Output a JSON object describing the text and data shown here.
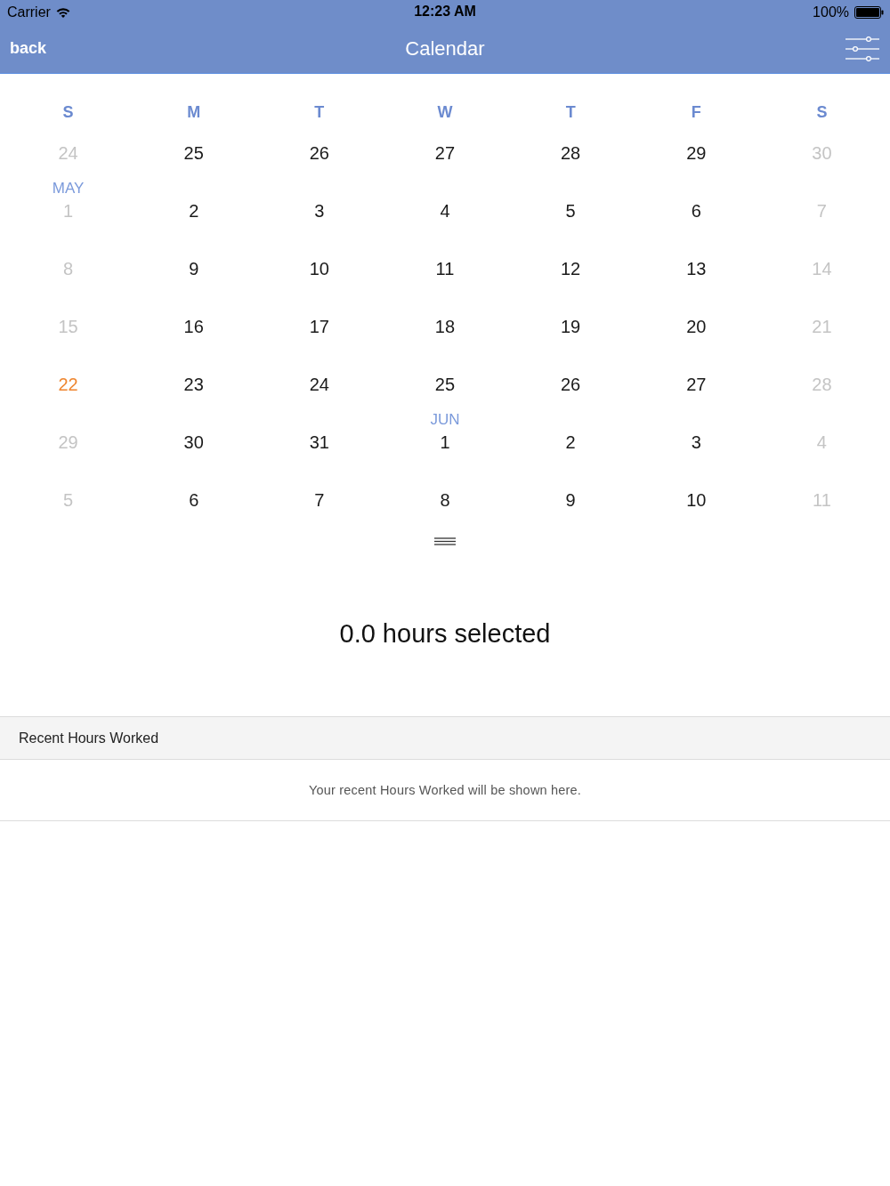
{
  "status_bar": {
    "carrier": "Carrier",
    "time": "12:23 AM",
    "battery": "100%"
  },
  "nav_bar": {
    "back": "back",
    "title": "Calendar"
  },
  "calendar": {
    "weekdays": [
      "S",
      "M",
      "T",
      "W",
      "T",
      "F",
      "S"
    ],
    "weeks": [
      [
        {
          "day": "24",
          "disabled": true,
          "today": false
        },
        {
          "day": "25",
          "disabled": false,
          "today": false
        },
        {
          "day": "26",
          "disabled": false,
          "today": false
        },
        {
          "day": "27",
          "disabled": false,
          "today": false
        },
        {
          "day": "28",
          "disabled": false,
          "today": false
        },
        {
          "day": "29",
          "disabled": false,
          "today": false
        },
        {
          "day": "30",
          "disabled": true,
          "today": false
        }
      ],
      [
        {
          "day": "1",
          "month": "MAY",
          "disabled": true,
          "today": false
        },
        {
          "day": "2",
          "disabled": false,
          "today": false
        },
        {
          "day": "3",
          "disabled": false,
          "today": false
        },
        {
          "day": "4",
          "disabled": false,
          "today": false
        },
        {
          "day": "5",
          "disabled": false,
          "today": false
        },
        {
          "day": "6",
          "disabled": false,
          "today": false
        },
        {
          "day": "7",
          "disabled": true,
          "today": false
        }
      ],
      [
        {
          "day": "8",
          "disabled": true,
          "today": false
        },
        {
          "day": "9",
          "disabled": false,
          "today": false
        },
        {
          "day": "10",
          "disabled": false,
          "today": false
        },
        {
          "day": "11",
          "disabled": false,
          "today": false
        },
        {
          "day": "12",
          "disabled": false,
          "today": false
        },
        {
          "day": "13",
          "disabled": false,
          "today": false
        },
        {
          "day": "14",
          "disabled": true,
          "today": false
        }
      ],
      [
        {
          "day": "15",
          "disabled": true,
          "today": false
        },
        {
          "day": "16",
          "disabled": false,
          "today": false
        },
        {
          "day": "17",
          "disabled": false,
          "today": false
        },
        {
          "day": "18",
          "disabled": false,
          "today": false
        },
        {
          "day": "19",
          "disabled": false,
          "today": false
        },
        {
          "day": "20",
          "disabled": false,
          "today": false
        },
        {
          "day": "21",
          "disabled": true,
          "today": false
        }
      ],
      [
        {
          "day": "22",
          "disabled": false,
          "today": true
        },
        {
          "day": "23",
          "disabled": false,
          "today": false
        },
        {
          "day": "24",
          "disabled": false,
          "today": false
        },
        {
          "day": "25",
          "disabled": false,
          "today": false
        },
        {
          "day": "26",
          "disabled": false,
          "today": false
        },
        {
          "day": "27",
          "disabled": false,
          "today": false
        },
        {
          "day": "28",
          "disabled": true,
          "today": false
        }
      ],
      [
        {
          "day": "29",
          "disabled": true,
          "today": false
        },
        {
          "day": "30",
          "disabled": false,
          "today": false
        },
        {
          "day": "31",
          "disabled": false,
          "today": false
        },
        {
          "day": "1",
          "month": "JUN",
          "disabled": false,
          "today": false
        },
        {
          "day": "2",
          "disabled": false,
          "today": false
        },
        {
          "day": "3",
          "disabled": false,
          "today": false
        },
        {
          "day": "4",
          "disabled": true,
          "today": false
        }
      ],
      [
        {
          "day": "5",
          "disabled": true,
          "today": false
        },
        {
          "day": "6",
          "disabled": false,
          "today": false
        },
        {
          "day": "7",
          "disabled": false,
          "today": false
        },
        {
          "day": "8",
          "disabled": false,
          "today": false
        },
        {
          "day": "9",
          "disabled": false,
          "today": false
        },
        {
          "day": "10",
          "disabled": false,
          "today": false
        },
        {
          "day": "11",
          "disabled": true,
          "today": false
        }
      ]
    ]
  },
  "summary": "0.0 hours selected",
  "recent_section": {
    "title": "Recent Hours Worked",
    "message": "Your recent Hours Worked will be shown here."
  }
}
